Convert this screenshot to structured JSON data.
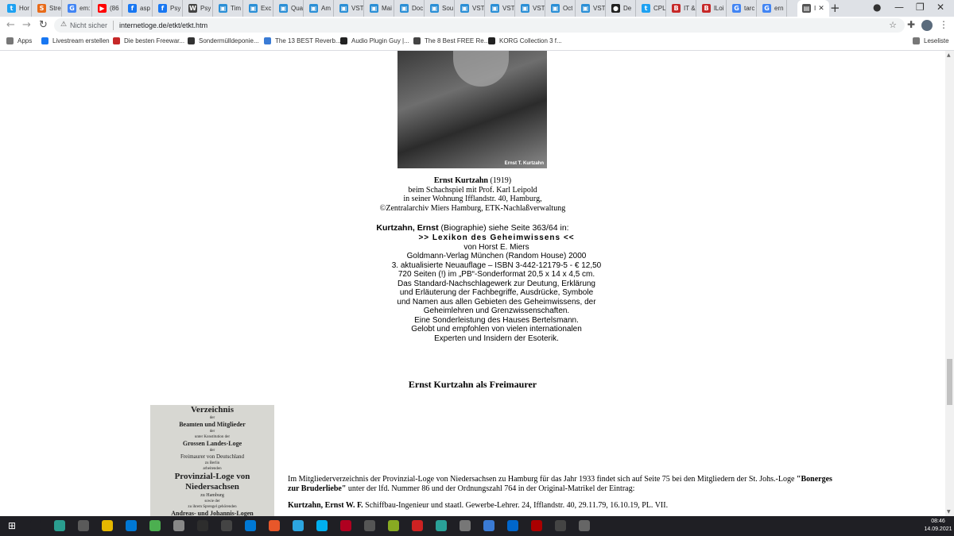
{
  "browser": {
    "tabs": [
      {
        "title": "Hor",
        "color": "#1da1f2",
        "glyph": "t"
      },
      {
        "title": "Stre",
        "color": "#e86b1a",
        "glyph": "S"
      },
      {
        "title": "em:",
        "color": "#4285f4",
        "glyph": "G"
      },
      {
        "title": "(86",
        "color": "#ff0000",
        "glyph": "▶"
      },
      {
        "title": "asp",
        "color": "#1877f2",
        "glyph": "f"
      },
      {
        "title": "Psy",
        "color": "#1877f2",
        "glyph": "f"
      },
      {
        "title": "Psy",
        "color": "#444444",
        "glyph": "W"
      },
      {
        "title": "Tim",
        "color": "#2b8fd6",
        "glyph": "▣"
      },
      {
        "title": "Exc",
        "color": "#2b8fd6",
        "glyph": "▣"
      },
      {
        "title": "Qua",
        "color": "#2b8fd6",
        "glyph": "▣"
      },
      {
        "title": "Am",
        "color": "#2b8fd6",
        "glyph": "▣"
      },
      {
        "title": "VST",
        "color": "#2b8fd6",
        "glyph": "▣"
      },
      {
        "title": "Mai",
        "color": "#2b8fd6",
        "glyph": "▣"
      },
      {
        "title": "Doc",
        "color": "#2b8fd6",
        "glyph": "▣"
      },
      {
        "title": "Sou",
        "color": "#2b8fd6",
        "glyph": "▣"
      },
      {
        "title": "VST",
        "color": "#2b8fd6",
        "glyph": "▣"
      },
      {
        "title": "VST",
        "color": "#2b8fd6",
        "glyph": "▣"
      },
      {
        "title": "VST",
        "color": "#2b8fd6",
        "glyph": "▣"
      },
      {
        "title": "Oct",
        "color": "#2b8fd6",
        "glyph": "▣"
      },
      {
        "title": "VST",
        "color": "#2b8fd6",
        "glyph": "▣"
      },
      {
        "title": "De",
        "color": "#222222",
        "glyph": "●"
      },
      {
        "title": "CPL",
        "color": "#1da1f2",
        "glyph": "t"
      },
      {
        "title": "IT &",
        "color": "#c62828",
        "glyph": "B"
      },
      {
        "title": "lLoi",
        "color": "#c62828",
        "glyph": "B"
      },
      {
        "title": "tarc",
        "color": "#4285f4",
        "glyph": "G"
      },
      {
        "title": "ern",
        "color": "#4285f4",
        "glyph": "G"
      }
    ],
    "active_tab": {
      "title": "I",
      "color": "#555555",
      "glyph": "▤"
    },
    "new_tab": "+",
    "window_controls": [
      "—",
      "❐",
      "✕"
    ],
    "address": {
      "security": "Nicht sicher",
      "url": "internetloge.de/etkt/etkt.htm"
    },
    "bookmarks": [
      {
        "label": "Apps",
        "color": "#777777"
      },
      {
        "label": "Livestream erstellen",
        "color": "#1877f2"
      },
      {
        "label": "Die besten Freewar...",
        "color": "#c62828"
      },
      {
        "label": "Sondermülldeponie...",
        "color": "#333333"
      },
      {
        "label": "The 13 BEST Reverb...",
        "color": "#3a7bd5"
      },
      {
        "label": "Audio Plugin Guy |...",
        "color": "#222222"
      },
      {
        "label": "The 8 Best FREE Re...",
        "color": "#444444"
      },
      {
        "label": "KORG Collection 3 f...",
        "color": "#222222"
      }
    ],
    "reading_list": "Leseliste"
  },
  "content": {
    "photo_caption": "Ernst T. Kurtzahn",
    "caption_name": "Ernst Kurtzahn",
    "caption_year": " (1919)",
    "caption_lines": [
      "beim Schachspiel mit Prof. Karl Leipold",
      "in seiner Wohnung Ifflandstr. 40, Hamburg,",
      "©Zentralarchiv Miers Hamburg, ETK-Nachlaßverwaltung"
    ],
    "bio_name": "Kurtzahn, Ernst",
    "bio_rest": " (Biographie) siehe Seite 363/64 in:",
    "lexikon_title": ">>  Lexikon  des  Geheimwissens  <<",
    "lexikon_lines": [
      "von Horst  E.  Miers",
      "Goldmann-Verlag München (Random House) 2000",
      "3. aktualisierte Neuauflage – ISBN 3-442-12179-5 - € 12,50",
      "720 Seiten (!) im „PB“-Sonderformat 20,5 x 14 x 4,5 cm.",
      "Das Standard-Nachschlagewerk zur Deutung, Erklärung",
      "und Erläuterung der Fachbegriffe, Ausdrücke, Symbole",
      "und Namen aus allen Gebieten des Geheimwissens, der",
      "Geheimlehren und Grenzwissenschaften.",
      "Eine Sonderleistung des Hauses Bertelsmann.",
      "Gelobt und empfohlen von vielen internationalen",
      "Experten und Insidern der Esoterik."
    ],
    "section_heading": "Ernst Kurtzahn als Freimaurer",
    "book_lines": [
      {
        "text": "Verzeichnis",
        "size": 11
      },
      {
        "text": "der",
        "size": 5
      },
      {
        "text": "Beamten und Mitglieder",
        "size": 8
      },
      {
        "text": "der",
        "size": 5
      },
      {
        "text": "unter Konstitution der",
        "size": 5
      },
      {
        "text": "Grossen Landes-Loge",
        "size": 8
      },
      {
        "text": "der",
        "size": 5
      },
      {
        "text": "Freimaurer von Deutschland",
        "size": 7
      },
      {
        "text": "zu Berlin",
        "size": 5
      },
      {
        "text": "arbeitenden",
        "size": 5
      },
      {
        "text": "Provinzial-Loge von Niedersachsen",
        "size": 11
      },
      {
        "text": "zu Hamburg",
        "size": 6
      },
      {
        "text": "sowie der",
        "size": 5
      },
      {
        "text": "zu ihrem Sprengel gehörenden",
        "size": 5
      },
      {
        "text": "Andreas- und Johannis-Logen",
        "size": 8
      }
    ],
    "member_text_1": "Im Mitgliederverzeichnis der Provinzial-Loge von Niedersachsen zu Hamburg für das Jahr 1933 findet sich auf Seite 75 bei den Mitgliedern der St. Johs.-Loge ",
    "member_lodge": "\"Bonerges zur Bruderliebe\"",
    "member_text_2": " unter der lfd. Nummer 86 und der Ordnungszahl 764 in der Original-Matrikel der Eintrag:",
    "entry_name": "Kurtzahn, Ernst W. F.",
    "entry_rest": " Schiffbau-Ingenieur und staatl. Gewerbe-Lehrer. 24, Ifflandstr. 40, 29.11.79, 16.10.19, PL. VII."
  },
  "taskbar": {
    "time": "08:46",
    "date": "14.09.2021",
    "apps": [
      {
        "name": "search",
        "color": "#1f1f24"
      },
      {
        "name": "edge",
        "color": "#2a9d8f"
      },
      {
        "name": "store",
        "color": "#5a5a5a"
      },
      {
        "name": "explorer",
        "color": "#e6b800"
      },
      {
        "name": "mail",
        "color": "#0078d4"
      },
      {
        "name": "chrome",
        "color": "#4caf50"
      },
      {
        "name": "app",
        "color": "#888888"
      },
      {
        "name": "app",
        "color": "#2d2d2d"
      },
      {
        "name": "live",
        "color": "#444444"
      },
      {
        "name": "app",
        "color": "#0078d4"
      },
      {
        "name": "app",
        "color": "#e8572a"
      },
      {
        "name": "telegram",
        "color": "#2ca5e0"
      },
      {
        "name": "skype",
        "color": "#00aff0"
      },
      {
        "name": "app",
        "color": "#b00020"
      },
      {
        "name": "app",
        "color": "#555555"
      },
      {
        "name": "app",
        "color": "#88aa22"
      },
      {
        "name": "app",
        "color": "#cc2222"
      },
      {
        "name": "app",
        "color": "#2aa198"
      },
      {
        "name": "app",
        "color": "#777777"
      },
      {
        "name": "app",
        "color": "#3a7bd5"
      },
      {
        "name": "app",
        "color": "#0066cc"
      },
      {
        "name": "app",
        "color": "#aa0000"
      },
      {
        "name": "app",
        "color": "#444444"
      },
      {
        "name": "app",
        "color": "#666666"
      }
    ]
  }
}
